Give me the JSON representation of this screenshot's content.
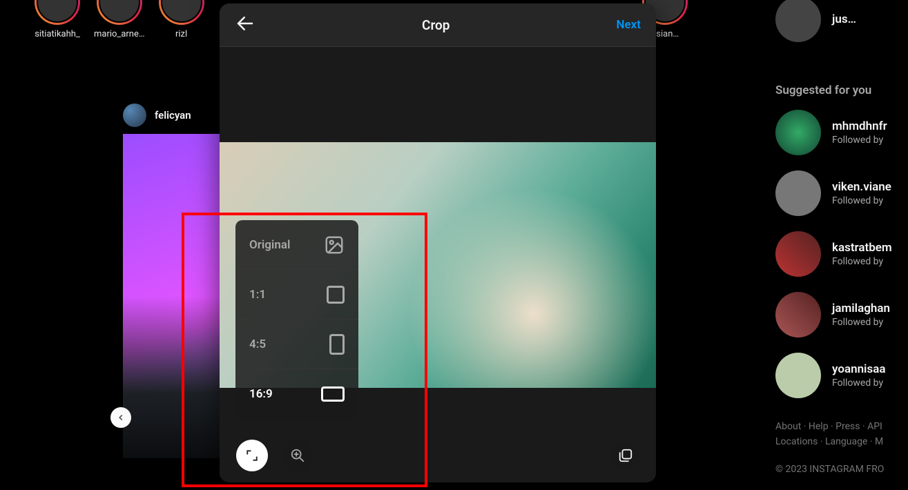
{
  "stories": [
    {
      "username": "sitiatikahh_"
    },
    {
      "username": "mario_arne…"
    },
    {
      "username": "rizl"
    },
    {
      "username": "osian…"
    }
  ],
  "post": {
    "username": "felicyan"
  },
  "right": {
    "top_username": "jus…",
    "suggested_title": "Suggested for you",
    "items": [
      {
        "name": "mhmdhnfr",
        "meta": "Followed by "
      },
      {
        "name": "viken.viane",
        "meta": "Followed by "
      },
      {
        "name": "kastratbem",
        "meta": "Followed by "
      },
      {
        "name": "jamilaghan",
        "meta": "Followed by "
      },
      {
        "name": "yoannisaa",
        "meta": "Followed by "
      }
    ],
    "footer_line1": "About · Help · Press · API",
    "footer_line2": "Locations · Language · M",
    "copyright": "© 2023 INSTAGRAM FRO"
  },
  "modal": {
    "title": "Crop",
    "next": "Next",
    "crop_options": {
      "original": "Original",
      "one_one": "1:1",
      "four_five": "4:5",
      "sixteen_nine": "16:9"
    }
  }
}
